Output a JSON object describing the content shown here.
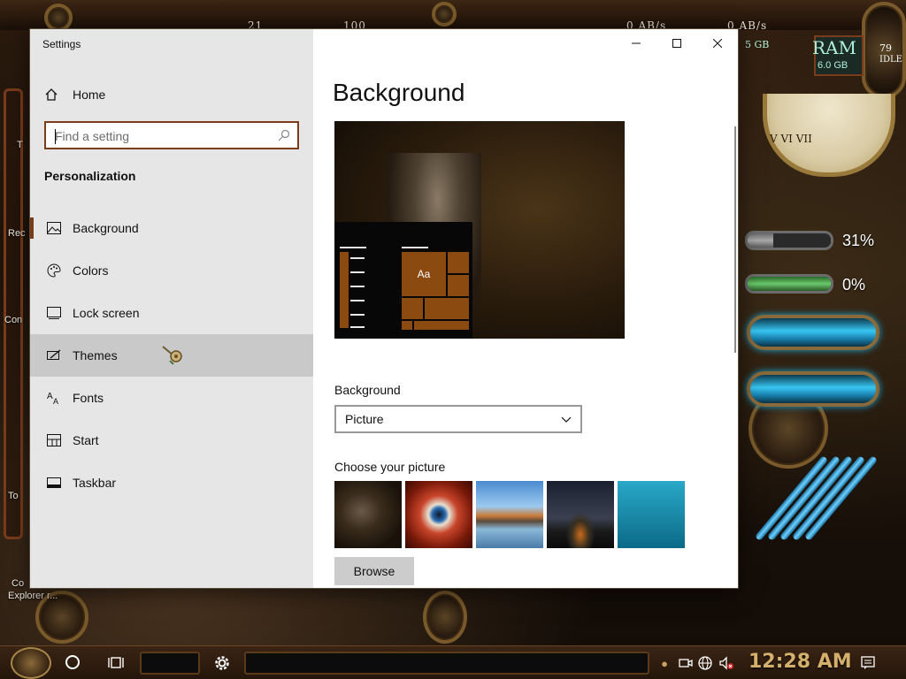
{
  "desktop": {
    "top_stats": [
      "21",
      "100",
      "0 AB/s",
      "0 AB/s"
    ],
    "ram_label": "RAM",
    "ram_value": "6.0 GB",
    "ram_side": "5 GB",
    "idle_value": "79",
    "idle_label": "IDLE",
    "meter1_value": "31%",
    "meter1_fraction": 0.31,
    "meter2_value": "0%",
    "meter2_fraction": 0.0,
    "icon_labels": [
      "T",
      "Rec",
      "Con",
      "To",
      "Co",
      "Explorer r..."
    ],
    "clock_numerals": "V  VI  VII"
  },
  "window": {
    "title": "Settings",
    "controls": {
      "minimize": "minimize",
      "maximize": "maximize",
      "close": "close"
    }
  },
  "nav": {
    "home_label": "Home",
    "search_placeholder": "Find a setting",
    "section_title": "Personalization",
    "items": [
      {
        "label": "Background",
        "icon": "image-icon"
      },
      {
        "label": "Colors",
        "icon": "palette-icon"
      },
      {
        "label": "Lock screen",
        "icon": "lock-screen-icon"
      },
      {
        "label": "Themes",
        "icon": "themes-icon"
      },
      {
        "label": "Fonts",
        "icon": "fonts-icon"
      },
      {
        "label": "Start",
        "icon": "start-icon"
      },
      {
        "label": "Taskbar",
        "icon": "taskbar-icon"
      }
    ],
    "active_item": "Background",
    "hovered_item": "Themes"
  },
  "content": {
    "page_title": "Background",
    "preview_tile_text": "Aa",
    "background_label": "Background",
    "background_value": "Picture",
    "choose_label": "Choose your picture",
    "browse_label": "Browse"
  },
  "taskbar": {
    "clock": "12:28 AM"
  },
  "colors": {
    "accent": "#7a3c1a",
    "tile": "#8a4a10",
    "clock": "#d4b06a"
  }
}
